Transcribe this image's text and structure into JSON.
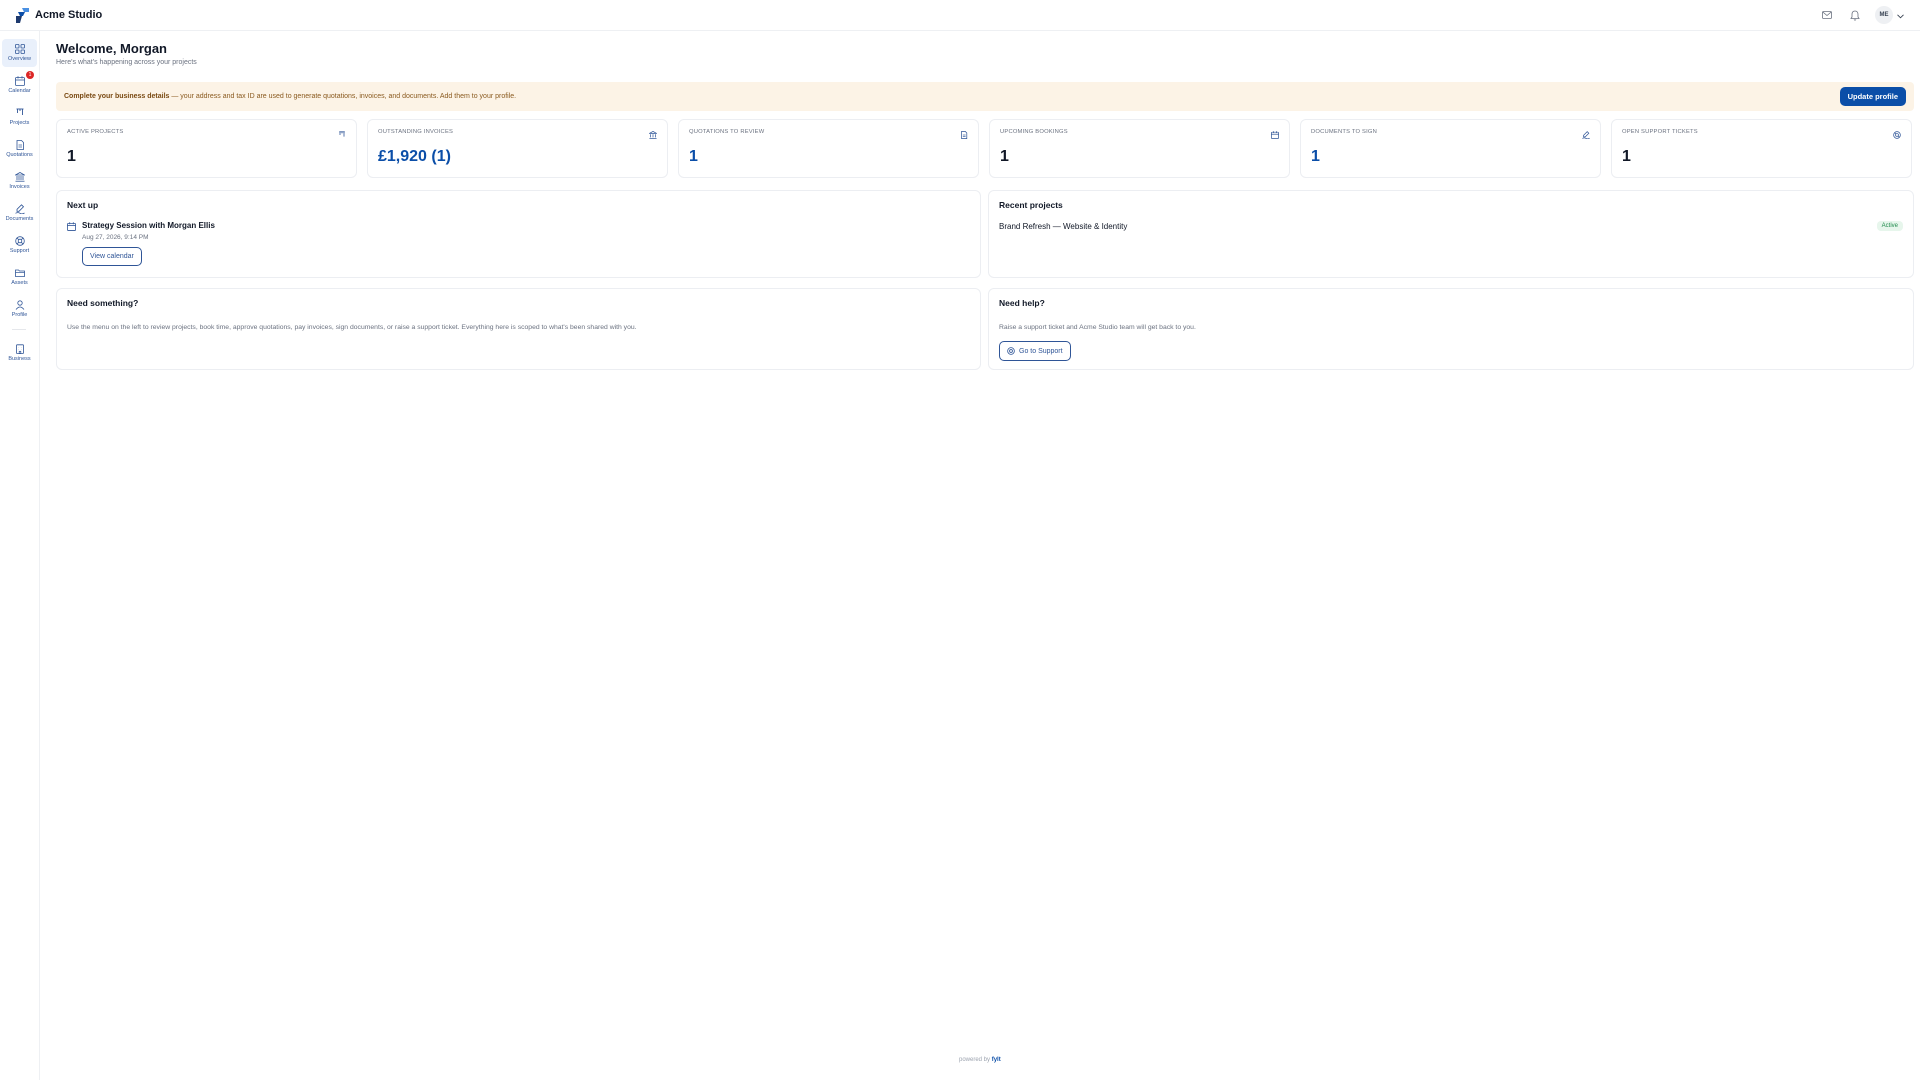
{
  "app": {
    "brand_name": "Acme Studio",
    "avatar_initials": "ME",
    "colors": {
      "accent": "#0b4ea8",
      "nav": "#2f5597",
      "banner_bg": "#fcf3e6",
      "badge": "#dc2626",
      "success": "#1f8a4c"
    }
  },
  "topbar": {
    "icons": [
      "mail-icon",
      "bell-icon",
      "chevron-down-icon"
    ]
  },
  "sidebar": {
    "items": [
      {
        "label": "Overview",
        "icon": "grid-icon",
        "active": true
      },
      {
        "label": "Calendar",
        "icon": "calendar-icon",
        "badge": "1"
      },
      {
        "label": "Projects",
        "icon": "projects-icon"
      },
      {
        "label": "Quotations",
        "icon": "document-icon"
      },
      {
        "label": "Invoices",
        "icon": "bank-icon"
      },
      {
        "label": "Documents",
        "icon": "signature-icon"
      },
      {
        "label": "Support",
        "icon": "lifebuoy-icon"
      },
      {
        "label": "Assets",
        "icon": "folder-icon"
      },
      {
        "label": "Profile",
        "icon": "user-icon"
      },
      {
        "label": "Business",
        "icon": "building-icon"
      }
    ]
  },
  "header": {
    "title": "Welcome, Morgan",
    "subtitle": "Here's what's happening across your projects"
  },
  "banner": {
    "bold": "Complete your business details",
    "text": " — your address and tax ID are used to generate quotations, invoices, and documents. Add them to your profile.",
    "button": "Update profile"
  },
  "stats": [
    {
      "label": "Active projects",
      "value": "1",
      "icon": "projects-icon",
      "highlight": false
    },
    {
      "label": "Outstanding invoices",
      "value": "£1,920 (1)",
      "icon": "bank-icon",
      "highlight": true
    },
    {
      "label": "Quotations to review",
      "value": "1",
      "icon": "document-icon",
      "highlight": true
    },
    {
      "label": "Upcoming bookings",
      "value": "1",
      "icon": "calendar-icon",
      "highlight": false
    },
    {
      "label": "Documents to sign",
      "value": "1",
      "icon": "signature-icon",
      "highlight": true
    },
    {
      "label": "Open support tickets",
      "value": "1",
      "icon": "lifebuoy-icon",
      "highlight": false
    }
  ],
  "next_up": {
    "title": "Next up",
    "event_title": "Strategy Session with Morgan Ellis",
    "event_date": "Aug 27, 2026, 9:14 PM",
    "button": "View calendar"
  },
  "recent_projects": {
    "title": "Recent projects",
    "project_name": "Brand Refresh — Website & Identity",
    "status": "Active"
  },
  "need_something": {
    "title": "Need something?",
    "body": "Use the menu on the left to review projects, book time, approve quotations, pay invoices, sign documents, or raise a support ticket. Everything here is scoped to what's been shared with you."
  },
  "need_help": {
    "title": "Need help?",
    "body": "Raise a support ticket and Acme Studio team will get back to you.",
    "button": "Go to Support"
  },
  "footer": {
    "prefix": "powered by",
    "brand": "fylt"
  }
}
